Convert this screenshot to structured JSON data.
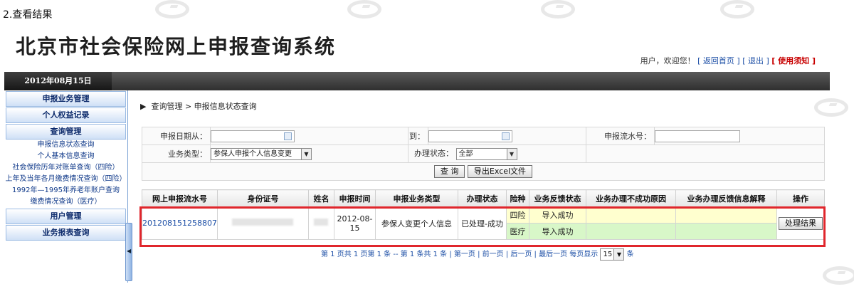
{
  "step_label": "2.查看结果",
  "system_title": "北京市社会保险网上申报查询系统",
  "top_links": {
    "greeting": "用户，欢迎您！",
    "home": "[ 返回首页 ]",
    "logout": "[ 退出 ]",
    "notice": "[ 使用须知 ]"
  },
  "date": "2012年08月15日",
  "sidebar": {
    "cat_apply": "申报业务管理",
    "cat_rights": "个人权益记录",
    "cat_query": "查询管理",
    "sub": [
      "申报信息状态查询",
      "个人基本信息查询",
      "社会保险历年对账单查询（四险）",
      "上年及当年各月缴费情况查询（四险）",
      "1992年—1995年养老年账户查询",
      "缴费情况查询（医疗）"
    ],
    "cat_user": "用户管理",
    "cat_report": "业务报表查询"
  },
  "breadcrumb": "查询管理 > 申报信息状态查询",
  "search": {
    "date_from_label": "申报日期从：",
    "date_to_label": "到：",
    "serial_label": "申报流水号：",
    "biz_type_label": "业务类型：",
    "biz_type_value": "参保人申报个人信息变更",
    "status_label": "办理状态：",
    "status_value": "全部",
    "query_button": "查 询",
    "export_button": "导出Excel文件"
  },
  "table": {
    "headers": [
      "网上申报流水号",
      "身份证号",
      "姓名",
      "申报时间",
      "申报业务类型",
      "办理状态",
      "险种",
      "业务反馈状态",
      "业务办理不成功原因",
      "业务办理反馈信息解释",
      "操作"
    ],
    "row": {
      "serial": "201208151258807",
      "date": "2012-08-15",
      "biz_type": "参保人变更个人信息",
      "status": "已处理-成功",
      "ins1": "四险",
      "fb1": "导入成功",
      "ins2": "医疗",
      "fb2": "导入成功",
      "action": "处理结果"
    }
  },
  "pagination": {
    "text": "第 1 页共 1 页第 1 条 -- 第 1 条共 1 条 | 第一页 | 前一页 | 后一页 | 最后一页 每页显示",
    "per_page": "15",
    "suffix": "条"
  }
}
